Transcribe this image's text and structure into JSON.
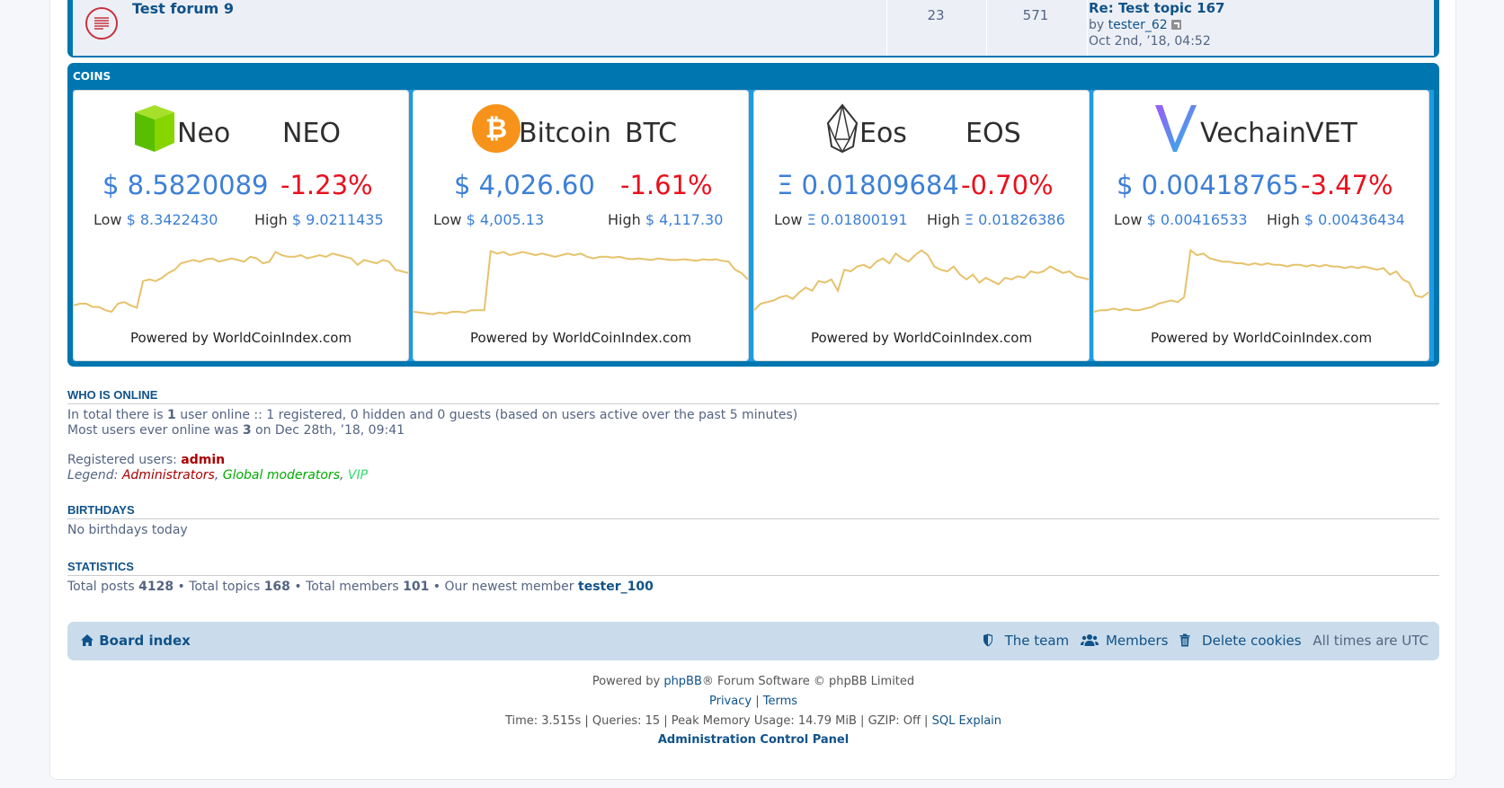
{
  "forum_row": {
    "title": "Test forum 9",
    "topics": "23",
    "posts": "571",
    "last_post_title": "Re: Test topic 167",
    "last_post_by_label": "by",
    "last_post_author": "tester_62",
    "last_post_time": "Oct 2nd, ’18, 04:52"
  },
  "coins": {
    "header": "COINS",
    "powered_by": "Powered by WorldCoinIndex.com",
    "low_label": "Low",
    "high_label": "High",
    "items": [
      {
        "name": "Neo",
        "symbol": "NEO",
        "price": "$ 8.5820089",
        "change": "-1.23%",
        "low": "$ 8.3422430",
        "high": "$ 9.0211435",
        "icon": "neo-logo-icon",
        "color": "#58bf00",
        "trend": [
          0.18,
          0.2,
          0.2,
          0.16,
          0.16,
          0.12,
          0.1,
          0.2,
          0.22,
          0.18,
          0.15,
          0.48,
          0.5,
          0.48,
          0.52,
          0.58,
          0.62,
          0.7,
          0.72,
          0.74,
          0.72,
          0.75,
          0.76,
          0.72,
          0.74,
          0.76,
          0.74,
          0.72,
          0.78,
          0.76,
          0.7,
          0.72,
          0.84,
          0.8,
          0.78,
          0.78,
          0.8,
          0.76,
          0.78,
          0.8,
          0.78,
          0.82,
          0.8,
          0.78,
          0.76,
          0.68,
          0.74,
          0.72,
          0.7,
          0.74,
          0.72,
          0.62,
          0.6,
          0.58
        ]
      },
      {
        "name": "Bitcoin",
        "symbol": "BTC",
        "price": "$ 4,026.60",
        "change": "-1.61%",
        "low": "$ 4,005.13",
        "high": "$ 4,117.30",
        "icon": "bitcoin-logo-icon",
        "color": "#f7931a",
        "trend": [
          0.1,
          0.09,
          0.08,
          0.07,
          0.09,
          0.08,
          0.1,
          0.1,
          0.09,
          0.12,
          0.12,
          0.12,
          0.85,
          0.82,
          0.84,
          0.8,
          0.82,
          0.84,
          0.82,
          0.8,
          0.82,
          0.8,
          0.78,
          0.8,
          0.82,
          0.8,
          0.82,
          0.78,
          0.76,
          0.78,
          0.78,
          0.77,
          0.78,
          0.76,
          0.75,
          0.76,
          0.75,
          0.74,
          0.76,
          0.75,
          0.74,
          0.74,
          0.75,
          0.74,
          0.73,
          0.75,
          0.74,
          0.75,
          0.73,
          0.72,
          0.62,
          0.58,
          0.5
        ]
      },
      {
        "name": "Eos",
        "symbol": "EOS",
        "price": "Ξ 0.01809684",
        "change": "-0.70%",
        "low": "Ξ 0.01800191",
        "high": "Ξ 0.01826386",
        "icon": "eos-logo-icon",
        "color": "#333333",
        "trend": [
          0.12,
          0.2,
          0.22,
          0.24,
          0.28,
          0.3,
          0.26,
          0.34,
          0.4,
          0.36,
          0.48,
          0.46,
          0.5,
          0.36,
          0.62,
          0.6,
          0.66,
          0.68,
          0.64,
          0.72,
          0.76,
          0.7,
          0.82,
          0.76,
          0.72,
          0.8,
          0.86,
          0.8,
          0.66,
          0.62,
          0.6,
          0.66,
          0.56,
          0.5,
          0.56,
          0.46,
          0.52,
          0.48,
          0.44,
          0.52,
          0.5,
          0.54,
          0.52,
          0.6,
          0.58,
          0.6,
          0.66,
          0.62,
          0.58,
          0.6,
          0.54,
          0.52,
          0.5
        ]
      },
      {
        "name": "Vechain",
        "symbol": "VET",
        "price": "$ 0.00418765",
        "change": "-3.47%",
        "low": "$ 0.00416533",
        "high": "$ 0.00436434",
        "icon": "vechain-logo-icon",
        "color": "#7b5cf5",
        "trend": [
          0.1,
          0.12,
          0.12,
          0.14,
          0.12,
          0.14,
          0.12,
          0.12,
          0.14,
          0.16,
          0.2,
          0.22,
          0.24,
          0.22,
          0.28,
          0.86,
          0.8,
          0.82,
          0.76,
          0.74,
          0.72,
          0.72,
          0.7,
          0.7,
          0.68,
          0.7,
          0.68,
          0.7,
          0.68,
          0.68,
          0.66,
          0.68,
          0.68,
          0.66,
          0.68,
          0.66,
          0.68,
          0.66,
          0.66,
          0.64,
          0.66,
          0.64,
          0.66,
          0.64,
          0.62,
          0.64,
          0.56,
          0.6,
          0.5,
          0.46,
          0.3,
          0.28,
          0.34
        ]
      }
    ]
  },
  "online": {
    "heading": "WHO IS ONLINE",
    "line1_a": "In total there is ",
    "line1_n": "1",
    "line1_b": " user online :: 1 registered, 0 hidden and 0 guests (based on users active over the past 5 minutes)",
    "line2_a": "Most users ever online was ",
    "line2_n": "3",
    "line2_b": " on Dec 28th, ’18, 09:41",
    "registered_label": "Registered users: ",
    "registered_user": "admin",
    "legend_label": "Legend:",
    "legend_admin": "Administrators",
    "legend_gmod": "Global moderators",
    "legend_vip": "VIP"
  },
  "birthdays": {
    "heading": "BIRTHDAYS",
    "text": "No birthdays today"
  },
  "statistics": {
    "heading": "STATISTICS",
    "posts_label": "Total posts ",
    "posts": "4128",
    "topics_label": " • Total topics ",
    "topics": "168",
    "members_label": " • Total members ",
    "members": "101",
    "newest_label": " • Our newest member ",
    "newest": "tester_100"
  },
  "navbar": {
    "board_index": "Board index",
    "team": "The team",
    "members": "Members",
    "delete_cookies": "Delete cookies",
    "timezone": "All times are UTC"
  },
  "footer": {
    "powered_a": "Powered by ",
    "phpbb": "phpBB",
    "powered_b": "® Forum Software © phpBB Limited",
    "privacy": "Privacy",
    "sep": " | ",
    "terms": "Terms",
    "debug_a": "Time: 3.515s | Queries: 15 | Peak Memory Usage: 14.79 MiB | GZIP: Off | ",
    "sql_explain": "SQL Explain",
    "acp": "Administration Control Panel"
  }
}
